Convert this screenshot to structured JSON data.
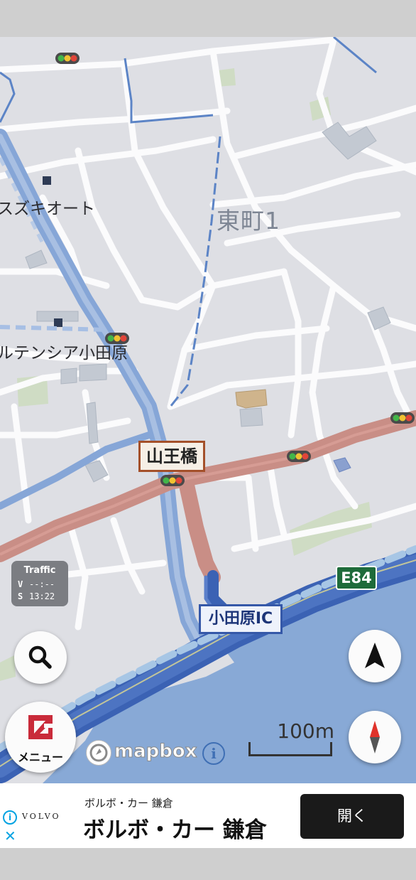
{
  "map": {
    "district_label": "東町1",
    "poi_labels": [
      "スズキオート",
      "ルテンシア小田原"
    ],
    "bridge_label": "山王橋",
    "interchange_label": "小田原IC",
    "route_shield": "E84"
  },
  "traffic_panel": {
    "title": "Traffic",
    "v_label": "V",
    "v_value": "--:--",
    "s_label": "S",
    "s_value": "13:22"
  },
  "controls": {
    "menu_label": "メニュー",
    "search_icon": "search-icon",
    "navigation_icon": "navigation-arrow-icon",
    "compass_icon": "compass-icon"
  },
  "attribution": {
    "provider": "mapbox",
    "info_glyph": "i"
  },
  "scale_bar": {
    "label": "100m"
  },
  "ad": {
    "brand_wordmark": "VOLVO",
    "small_text": "ボルボ・カー 鎌倉",
    "headline": "ボルボ・カー 鎌倉",
    "cta_label": "開く",
    "info_glyph": "i",
    "close_glyph": "✕"
  },
  "colors": {
    "map_background": "#dedfe4",
    "water": "#88a9d6",
    "major_road": "#c98e86",
    "highway": "#3b62b4",
    "secondary_blue": "#86a6d7",
    "green_area": "#cfdcc4"
  }
}
